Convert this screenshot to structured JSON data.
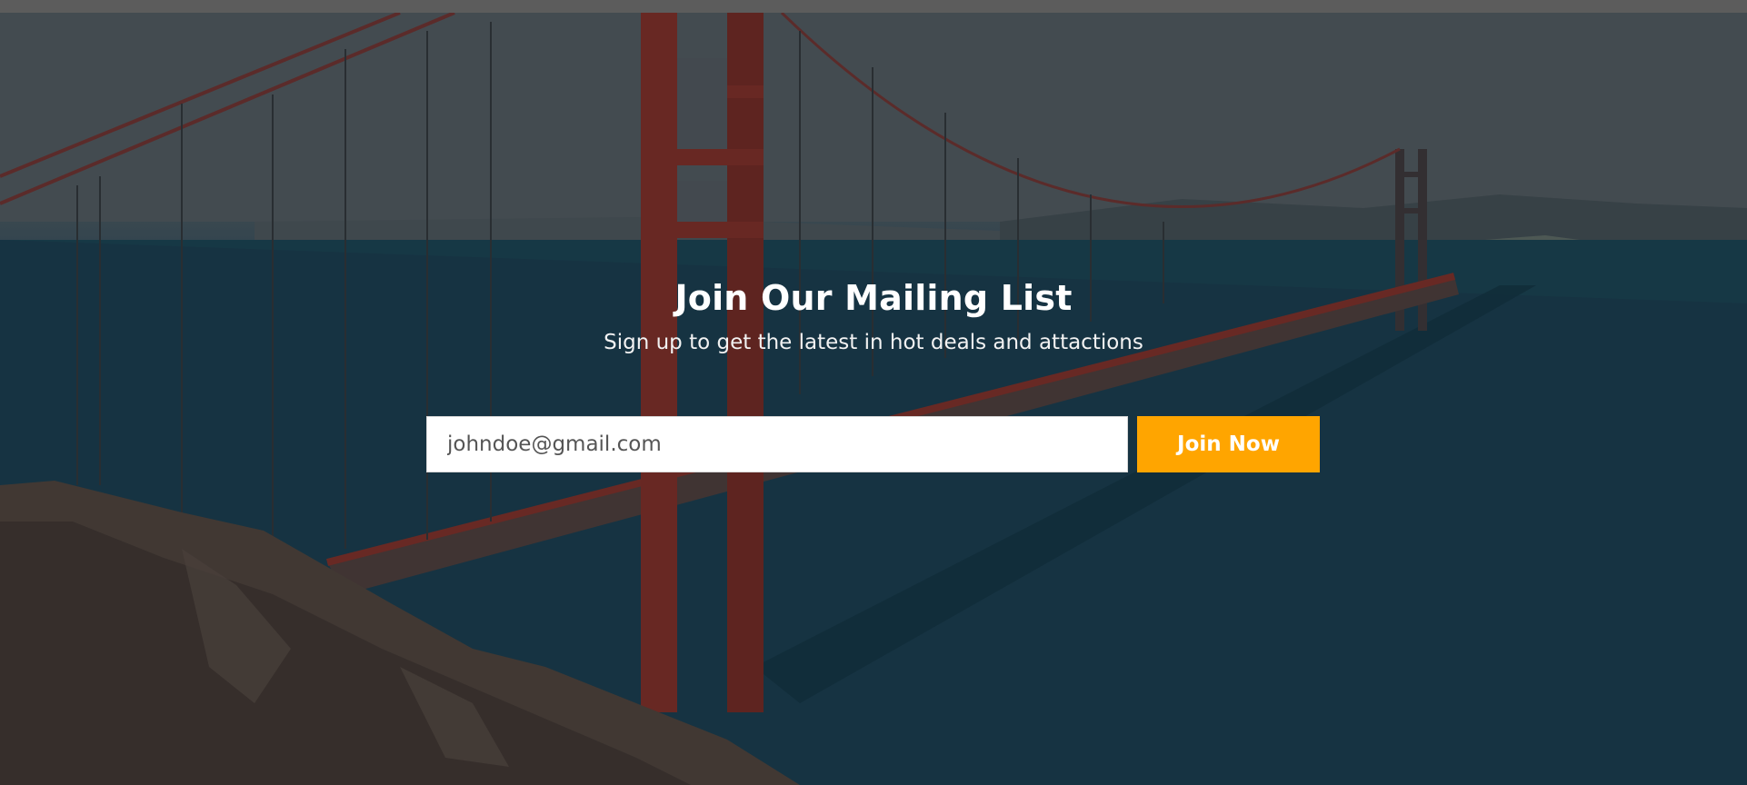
{
  "hero": {
    "title": "Join Our Mailing List",
    "subtitle": "Sign up to get the latest in hot deals and attactions",
    "background_image": "golden-gate-bridge-photo"
  },
  "signup_form": {
    "email_value": "johndoe@gmail.com",
    "email_placeholder": "johndoe@gmail.com",
    "submit_label": "Join Now"
  },
  "colors": {
    "accent": "#ffa500",
    "text": "#ffffff",
    "input_bg": "#ffffff",
    "input_text": "#555555"
  }
}
